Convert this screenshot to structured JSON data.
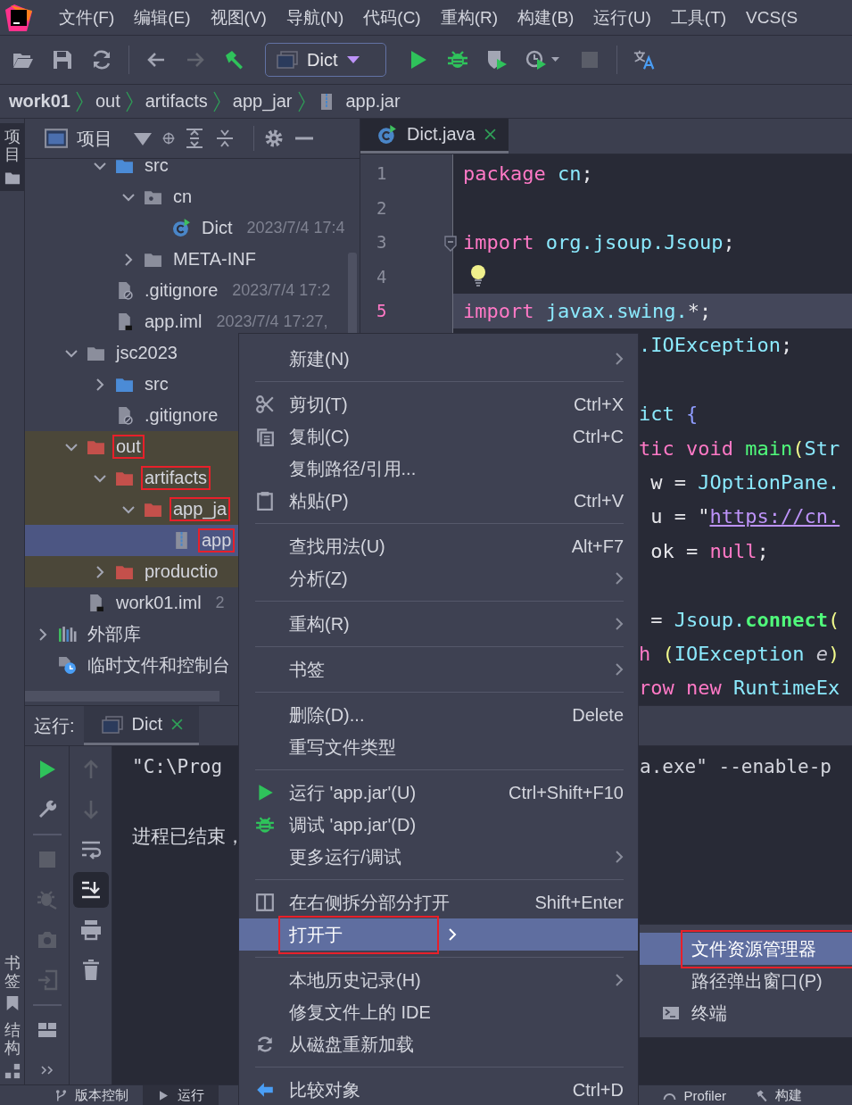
{
  "menubar": {
    "items": [
      "文件(F)",
      "编辑(E)",
      "视图(V)",
      "导航(N)",
      "代码(C)",
      "重构(R)",
      "构建(B)",
      "运行(U)",
      "工具(T)",
      "VCS(S"
    ]
  },
  "toolbar": {
    "run_config": "Dict"
  },
  "breadcrumbs": [
    {
      "label": "work01",
      "kind": "project"
    },
    {
      "label": "out",
      "kind": "folder"
    },
    {
      "label": "artifacts",
      "kind": "folder"
    },
    {
      "label": "app_jar",
      "kind": "folder"
    },
    {
      "label": "app.jar",
      "kind": "jar"
    }
  ],
  "left_stripe": [
    {
      "label": "项目",
      "kind": "project",
      "selected": true
    },
    {
      "label": "书签",
      "kind": "bookmarks",
      "selected": false
    },
    {
      "label": "结构",
      "kind": "structure",
      "selected": false
    }
  ],
  "project": {
    "title": "项目",
    "tree": [
      {
        "children": [
          {
            "children": [
              {
                "label": "src",
                "kind": "source-folder",
                "expanded": true,
                "selected": false,
                "excluded": false,
                "annotated": false,
                "children": [
                  {
                    "label": "cn",
                    "kind": "package",
                    "expanded": true,
                    "selected": false,
                    "excluded": false,
                    "annotated": false,
                    "children": [
                      {
                        "label": "Dict",
                        "kind": "class",
                        "date": "2023/7/4 17:4",
                        "selected": false,
                        "excluded": false,
                        "annotated": false
                      }
                    ]
                  },
                  {
                    "label": "META-INF",
                    "kind": "folder",
                    "expanded": false,
                    "selected": false,
                    "excluded": false,
                    "annotated": false
                  }
                ]
              },
              {
                "label": ".gitignore",
                "kind": "ignore-file",
                "date": "2023/7/4 17:2",
                "selected": false,
                "excluded": false,
                "annotated": false
              },
              {
                "label": "app.iml",
                "kind": "module-file",
                "date": "2023/7/4 17:27,",
                "selected": false,
                "excluded": false,
                "annotated": false
              }
            ]
          },
          {
            "label": "jsc2023",
            "kind": "folder",
            "expanded": true,
            "selected": false,
            "excluded": false,
            "annotated": false,
            "children": [
              {
                "label": "src",
                "kind": "source-folder",
                "expanded": false,
                "selected": false,
                "excluded": false,
                "annotated": false
              },
              {
                "label": ".gitignore",
                "kind": "ignore-file",
                "selected": false,
                "excluded": false,
                "annotated": false
              }
            ]
          },
          {
            "label": "out",
            "kind": "excluded-folder",
            "expanded": true,
            "selected": false,
            "excluded": true,
            "annotated": true,
            "children": [
              {
                "label": "artifacts",
                "kind": "excluded-folder",
                "expanded": true,
                "selected": false,
                "excluded": true,
                "annotated": true,
                "children": [
                  {
                    "label": "app_ja",
                    "kind": "excluded-folder",
                    "expanded": true,
                    "selected": false,
                    "excluded": true,
                    "annotated": true,
                    "children": [
                      {
                        "label": "app",
                        "kind": "jar",
                        "selected": true,
                        "excluded": false,
                        "annotated": true
                      }
                    ]
                  }
                ]
              },
              {
                "label": "productio",
                "kind": "excluded-folder",
                "expanded": false,
                "selected": false,
                "excluded": true,
                "annotated": false
              }
            ]
          },
          {
            "label": "work01.iml",
            "kind": "module-file",
            "date": "2",
            "selected": false,
            "excluded": false,
            "annotated": false
          }
        ]
      },
      {
        "label": "外部库",
        "kind": "library",
        "expanded": false,
        "selected": false,
        "excluded": false,
        "annotated": false
      },
      {
        "label": "临时文件和控制台",
        "kind": "scratch",
        "selected": false,
        "excluded": false,
        "annotated": false
      }
    ]
  },
  "editor": {
    "tab": {
      "label": "Dict.java",
      "selected": true
    },
    "lines": [
      {
        "num": "1",
        "current": false,
        "fold": false,
        "bulb": false,
        "tokens": [
          {
            "kind": "keyword",
            "t": "package "
          },
          {
            "kind": "identifier",
            "t": "cn"
          },
          {
            "kind": "plain",
            "t": ";"
          }
        ]
      },
      {
        "num": "2",
        "current": false,
        "fold": false,
        "bulb": false
      },
      {
        "num": "3",
        "current": false,
        "fold": true,
        "bulb": false,
        "tokens": [
          {
            "kind": "keyword",
            "t": "import "
          },
          {
            "kind": "identifier",
            "t": "org.jsoup.Jsoup"
          },
          {
            "kind": "plain",
            "t": ";"
          }
        ]
      },
      {
        "num": "4",
        "current": false,
        "fold": false,
        "bulb": true
      },
      {
        "num": "5",
        "current": true,
        "fold": false,
        "bulb": false,
        "tokens": [
          {
            "kind": "keyword",
            "t": "import "
          },
          {
            "kind": "identifier",
            "t": "javax.swing."
          },
          {
            "kind": "plain",
            "t": "*;"
          }
        ]
      }
    ],
    "covered_lines": [
      {
        "blank_before": false,
        "tokens": [
          {
            "kind": "identifier",
            "t": ".IOException"
          },
          {
            "kind": "plain",
            "t": ";"
          }
        ]
      },
      {
        "blank_before": true,
        "tokens": [
          {
            "kind": "identifier",
            "t": "ict "
          },
          {
            "kind": "brace",
            "t": "{"
          }
        ]
      },
      {
        "blank_before": false,
        "tokens": [
          {
            "kind": "keyword",
            "t": "tic void "
          },
          {
            "kind": "function",
            "t": "main"
          },
          {
            "kind": "paren",
            "t": "("
          },
          {
            "kind": "identifier",
            "t": "Str"
          }
        ]
      },
      {
        "blank_before": false,
        "tokens": [
          {
            "kind": "plain",
            "t": " w = "
          },
          {
            "kind": "identifier",
            "t": "JOptionPane."
          }
        ]
      },
      {
        "blank_before": false,
        "tokens": [
          {
            "kind": "plain",
            "t": " u = \""
          },
          {
            "kind": "link",
            "t": "https://cn."
          }
        ]
      },
      {
        "blank_before": false,
        "tokens": [
          {
            "kind": "plain",
            "t": " ok = "
          },
          {
            "kind": "keyword",
            "t": "null"
          },
          {
            "kind": "plain",
            "t": ";"
          }
        ]
      },
      {
        "blank_before": true,
        "tokens": [
          {
            "kind": "plain",
            "t": " = "
          },
          {
            "kind": "identifier",
            "t": "Jsoup."
          },
          {
            "kind": "call",
            "t": "connect"
          },
          {
            "kind": "paren",
            "t": "("
          }
        ]
      },
      {
        "blank_before": false,
        "tokens": [
          {
            "kind": "keyword",
            "t": "h "
          },
          {
            "kind": "paren",
            "t": "("
          },
          {
            "kind": "identifier",
            "t": "IOException "
          },
          {
            "kind": "parameter",
            "t": "e"
          },
          {
            "kind": "paren",
            "t": ")"
          }
        ]
      },
      {
        "blank_before": false,
        "tokens": [
          {
            "kind": "keyword",
            "t": "row new "
          },
          {
            "kind": "identifier",
            "t": "RuntimeEx"
          }
        ]
      }
    ]
  },
  "run": {
    "title": "运行:",
    "tab": {
      "label": "Dict",
      "selected": true
    },
    "console": [
      {
        "left": "\"C:\\Prog",
        "right": "a.exe\" --enable-p"
      },
      {
        "left": "进程已结束，"
      }
    ]
  },
  "bottom_tabs": [
    {
      "label": "版本控制",
      "kind": "vcs",
      "selected": false
    },
    {
      "label": "运行",
      "kind": "run",
      "selected": true
    },
    {
      "label": "Profiler",
      "kind": "profiler",
      "selected": false
    },
    {
      "label": "构建",
      "kind": "build",
      "selected": false
    }
  ],
  "context_menu": {
    "items": [
      {
        "kind": "plain",
        "label": "新建(N)",
        "submenu": true,
        "selected": false,
        "annotated": false
      },
      {
        "kind": "separator"
      },
      {
        "kind": "cut",
        "label": "剪切(T)",
        "shortcut": "Ctrl+X",
        "submenu": false,
        "selected": false,
        "annotated": false
      },
      {
        "kind": "copy",
        "label": "复制(C)",
        "shortcut": "Ctrl+C",
        "submenu": false,
        "selected": false,
        "annotated": false
      },
      {
        "kind": "plain",
        "label": "复制路径/引用...",
        "submenu": false,
        "selected": false,
        "annotated": false
      },
      {
        "kind": "paste",
        "label": "粘贴(P)",
        "shortcut": "Ctrl+V",
        "submenu": false,
        "selected": false,
        "annotated": false
      },
      {
        "kind": "separator"
      },
      {
        "kind": "plain",
        "label": "查找用法(U)",
        "shortcut": "Alt+F7",
        "submenu": false,
        "selected": false,
        "annotated": false
      },
      {
        "kind": "plain",
        "label": "分析(Z)",
        "submenu": true,
        "selected": false,
        "annotated": false
      },
      {
        "kind": "separator"
      },
      {
        "kind": "plain",
        "label": "重构(R)",
        "submenu": true,
        "selected": false,
        "annotated": false
      },
      {
        "kind": "separator"
      },
      {
        "kind": "plain",
        "label": "书签",
        "submenu": true,
        "selected": false,
        "annotated": false
      },
      {
        "kind": "separator"
      },
      {
        "kind": "plain",
        "label": "删除(D)...",
        "shortcut": "Delete",
        "submenu": false,
        "selected": false,
        "annotated": false
      },
      {
        "kind": "plain",
        "label": "重写文件类型",
        "submenu": false,
        "selected": false,
        "annotated": false
      },
      {
        "kind": "separator"
      },
      {
        "kind": "run",
        "label": "运行 'app.jar'(U)",
        "shortcut": "Ctrl+Shift+F10",
        "submenu": false,
        "selected": false,
        "annotated": false
      },
      {
        "kind": "debug",
        "label": "调试 'app.jar'(D)",
        "submenu": false,
        "selected": false,
        "annotated": false
      },
      {
        "kind": "plain",
        "label": "更多运行/调试",
        "submenu": true,
        "selected": false,
        "annotated": false
      },
      {
        "kind": "separator"
      },
      {
        "kind": "split",
        "label": "在右侧拆分部分打开",
        "shortcut": "Shift+Enter",
        "submenu": false,
        "selected": false,
        "annotated": false
      },
      {
        "kind": "plain",
        "label": "打开于",
        "submenu": true,
        "selected": true,
        "annotated": true
      },
      {
        "kind": "separator"
      },
      {
        "kind": "plain",
        "label": "本地历史记录(H)",
        "submenu": true,
        "selected": false,
        "annotated": false
      },
      {
        "kind": "plain",
        "label": "修复文件上的 IDE",
        "submenu": false,
        "selected": false,
        "annotated": false
      },
      {
        "kind": "reload",
        "label": "从磁盘重新加载",
        "submenu": false,
        "selected": false,
        "annotated": false
      },
      {
        "kind": "separator"
      },
      {
        "kind": "compare",
        "label": "比较对象",
        "shortcut": "Ctrl+D",
        "submenu": false,
        "selected": false,
        "annotated": false
      }
    ]
  },
  "submenu": {
    "items": [
      {
        "kind": "plain",
        "label": "文件资源管理器",
        "selected": true,
        "annotated": true
      },
      {
        "kind": "plain",
        "label": "路径弹出窗口(P)",
        "selected": false,
        "annotated": false
      },
      {
        "kind": "terminal",
        "label": "终端",
        "selected": false,
        "annotated": false
      }
    ]
  }
}
